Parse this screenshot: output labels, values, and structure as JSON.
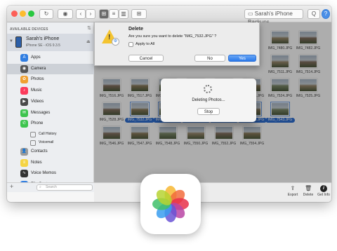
{
  "window": {
    "title_label": "Sarah's iPhone Backups",
    "search_label": "Q",
    "help_label": "?",
    "view_label": "≡▾",
    "group_label": "⊞"
  },
  "sidebar": {
    "header": "AVAILABLE DEVICES",
    "device_name": "Sarah's iPhone",
    "device_sub": "iPhone SE - iOS 9.3.5",
    "items": [
      {
        "label": "Apps",
        "color": "#2f7de1",
        "icon": "apps-icon",
        "glyph": "A"
      },
      {
        "label": "Camera",
        "color": "#555555",
        "icon": "camera-icon",
        "glyph": "◉"
      },
      {
        "label": "Photos",
        "color": "#f0a030",
        "icon": "photos-icon",
        "glyph": "✿"
      },
      {
        "label": "Music",
        "color": "#fb3b5b",
        "icon": "music-icon",
        "glyph": "♪"
      },
      {
        "label": "Videos",
        "color": "#4a4a4a",
        "icon": "videos-icon",
        "glyph": "▶"
      },
      {
        "label": "Messages",
        "color": "#3dc44e",
        "icon": "messages-icon",
        "glyph": "✉"
      },
      {
        "label": "Phone",
        "color": "#3dc44e",
        "icon": "phone-icon",
        "glyph": "✆"
      },
      {
        "label": "Call History",
        "color": "#888888",
        "icon": "call-history-icon",
        "glyph": ""
      },
      {
        "label": "Voicemail",
        "color": "#888888",
        "icon": "voicemail-icon",
        "glyph": ""
      },
      {
        "label": "Contacts",
        "color": "#9a9a9a",
        "icon": "contacts-icon",
        "glyph": "👤"
      },
      {
        "label": "Notes",
        "color": "#f5d442",
        "icon": "notes-icon",
        "glyph": "≡"
      },
      {
        "label": "Voice Memos",
        "color": "#333333",
        "icon": "voice-memos-icon",
        "glyph": "∿"
      },
      {
        "label": "File System",
        "color": "#2f7de1",
        "icon": "file-system-icon",
        "glyph": "▤"
      }
    ],
    "search_placeholder": "Search",
    "add_label": "+"
  },
  "photos": {
    "row1": [
      "IMG_7480.JPG",
      "IMG_7482.JPG"
    ],
    "row2": [
      "IMG_7511.JPG",
      "IMG_7514.JPG"
    ],
    "row3": [
      "IMG_7516.JPG",
      "IMG_7517.JPG",
      "IMG_7518.JPG",
      "IMG_7519.JPG",
      "IMG_7520.JPG",
      "IMG_7522.JPG",
      "IMG_7524.JPG",
      "IMG_7525.JPG"
    ],
    "row4": [
      "IMG_7528.JPG",
      "IMG_7532.JPG",
      "IMG_7536.JPG",
      "IMG_7538.JPG",
      "IMG_7539.JPG",
      "IMG_7541.JPG",
      "IMG_7543.JPG"
    ],
    "row5": [
      "IMG_7546.JPG",
      "IMG_7547.JPG",
      "IMG_7548.JPG",
      "IMG_7550.JPG",
      "IMG_7552.JPG",
      "IMG_7554.JPG"
    ]
  },
  "bottombar": {
    "export": "Export",
    "delete": "Delete",
    "info": "Get Info"
  },
  "sheet": {
    "title": "Delete",
    "message": "Are you sure you want to delete \"IMG_7532.JPG\" ?",
    "checkbox": "Apply to All",
    "cancel": "Cancel",
    "no": "No",
    "yes": "Yes"
  },
  "progress": {
    "text": "Deleting Photos...",
    "stop": "Stop"
  }
}
